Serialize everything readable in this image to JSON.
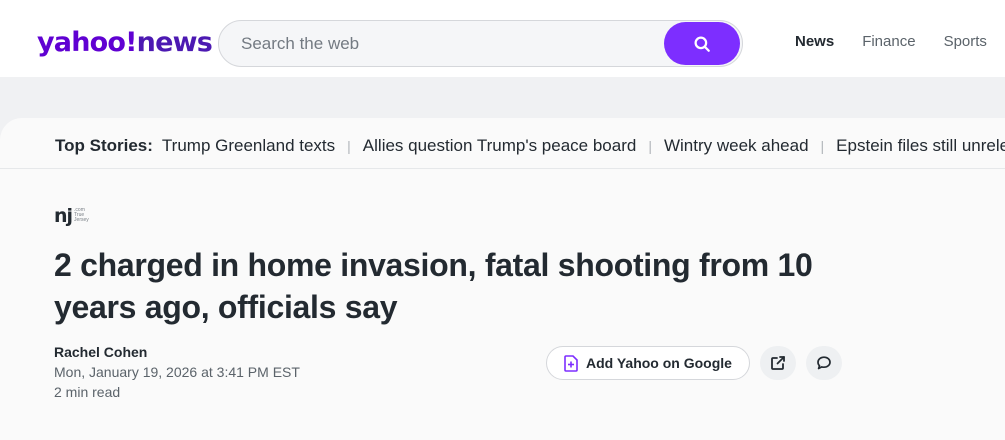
{
  "header": {
    "logo_yahoo": "yahoo!",
    "logo_news": "news",
    "search_placeholder": "Search the web",
    "search_icon": "search-icon",
    "nav": [
      {
        "label": "News",
        "active": true
      },
      {
        "label": "Finance",
        "active": false
      },
      {
        "label": "Sports",
        "active": false
      }
    ]
  },
  "top_stories": {
    "label": "Top Stories:",
    "items": [
      "Trump Greenland texts",
      "Allies question Trump's peace board",
      "Wintry week ahead",
      "Epstein files still unreleased"
    ]
  },
  "article": {
    "source_logo": "nj",
    "source_logo_small": ".com\nTrue\nJersey",
    "headline": "2 charged in home invasion, fatal shooting from 10 years ago, officials say",
    "author": "Rachel Cohen",
    "date": "Mon, January 19, 2026 at 3:41 PM EST",
    "read_time": "2 min read"
  },
  "actions": {
    "google_label": "Add Yahoo on Google",
    "google_icon": "plus-document-icon",
    "share_icon": "share-icon",
    "comment_icon": "comment-icon"
  },
  "colors": {
    "brand": "#6001d2",
    "search_button": "#7d2eff",
    "page_bg": "#f0f1f3"
  }
}
